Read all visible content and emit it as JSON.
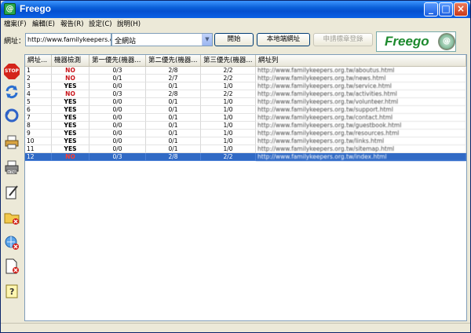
{
  "window": {
    "title": "Freego"
  },
  "menu": [
    "檔案(F)",
    "編輯(E)",
    "報告(R)",
    "設定(C)",
    "說明(H)"
  ],
  "address": {
    "label": "網址：",
    "value": "http://www.familykeepers.org.tw/",
    "scope": "全網站"
  },
  "buttons": {
    "start": "開始",
    "local": "本地端網址",
    "apply": "申請標章登錄"
  },
  "logo": {
    "text": "Freego",
    "badge": "@"
  },
  "table": {
    "headers": [
      "網址...",
      "機器檢測",
      "第一優先(機器...",
      "第二優先(機器...",
      "第三優先(機器...",
      "網址列"
    ],
    "rows": [
      {
        "id": "1",
        "det": "NO",
        "p1": "0/3",
        "p2": "2/8",
        "p3": "2/2",
        "url": "http://www.familykeepers.org.tw/aboutus.html"
      },
      {
        "id": "2",
        "det": "NO",
        "p1": "0/1",
        "p2": "2/7",
        "p3": "2/2",
        "url": "http://www.familykeepers.org.tw/news.html"
      },
      {
        "id": "3",
        "det": "YES",
        "p1": "0/0",
        "p2": "0/1",
        "p3": "1/0",
        "url": "http://www.familykeepers.org.tw/service.html"
      },
      {
        "id": "4",
        "det": "NO",
        "p1": "0/3",
        "p2": "2/8",
        "p3": "2/2",
        "url": "http://www.familykeepers.org.tw/activities.html"
      },
      {
        "id": "5",
        "det": "YES",
        "p1": "0/0",
        "p2": "0/1",
        "p3": "1/0",
        "url": "http://www.familykeepers.org.tw/volunteer.html"
      },
      {
        "id": "6",
        "det": "YES",
        "p1": "0/0",
        "p2": "0/1",
        "p3": "1/0",
        "url": "http://www.familykeepers.org.tw/support.html"
      },
      {
        "id": "7",
        "det": "YES",
        "p1": "0/0",
        "p2": "0/1",
        "p3": "1/0",
        "url": "http://www.familykeepers.org.tw/contact.html"
      },
      {
        "id": "8",
        "det": "YES",
        "p1": "0/0",
        "p2": "0/1",
        "p3": "1/0",
        "url": "http://www.familykeepers.org.tw/guestbook.html"
      },
      {
        "id": "9",
        "det": "YES",
        "p1": "0/0",
        "p2": "0/1",
        "p3": "1/0",
        "url": "http://www.familykeepers.org.tw/resources.html"
      },
      {
        "id": "10",
        "det": "YES",
        "p1": "0/0",
        "p2": "0/1",
        "p3": "1/0",
        "url": "http://www.familykeepers.org.tw/links.html"
      },
      {
        "id": "11",
        "det": "YES",
        "p1": "0/0",
        "p2": "0/1",
        "p3": "1/0",
        "url": "http://www.familykeepers.org.tw/sitemap.html"
      },
      {
        "id": "12",
        "det": "NO",
        "p1": "0/3",
        "p2": "2/8",
        "p3": "2/2",
        "url": "http://www.familykeepers.org.tw/index.html"
      }
    ],
    "selected_row": 12
  },
  "colors": {
    "title_bar": "#0a5fd8",
    "selection": "#316ac5",
    "no_text": "#c8141a",
    "window_bg": "#ece9d8"
  },
  "left_tools": [
    "stop-icon",
    "refresh-icon",
    "sync-icon",
    "print-icon",
    "print-report-icon",
    "edit-icon",
    "folder-delete-icon",
    "globe-delete-icon",
    "page-delete-icon",
    "help-icon"
  ]
}
